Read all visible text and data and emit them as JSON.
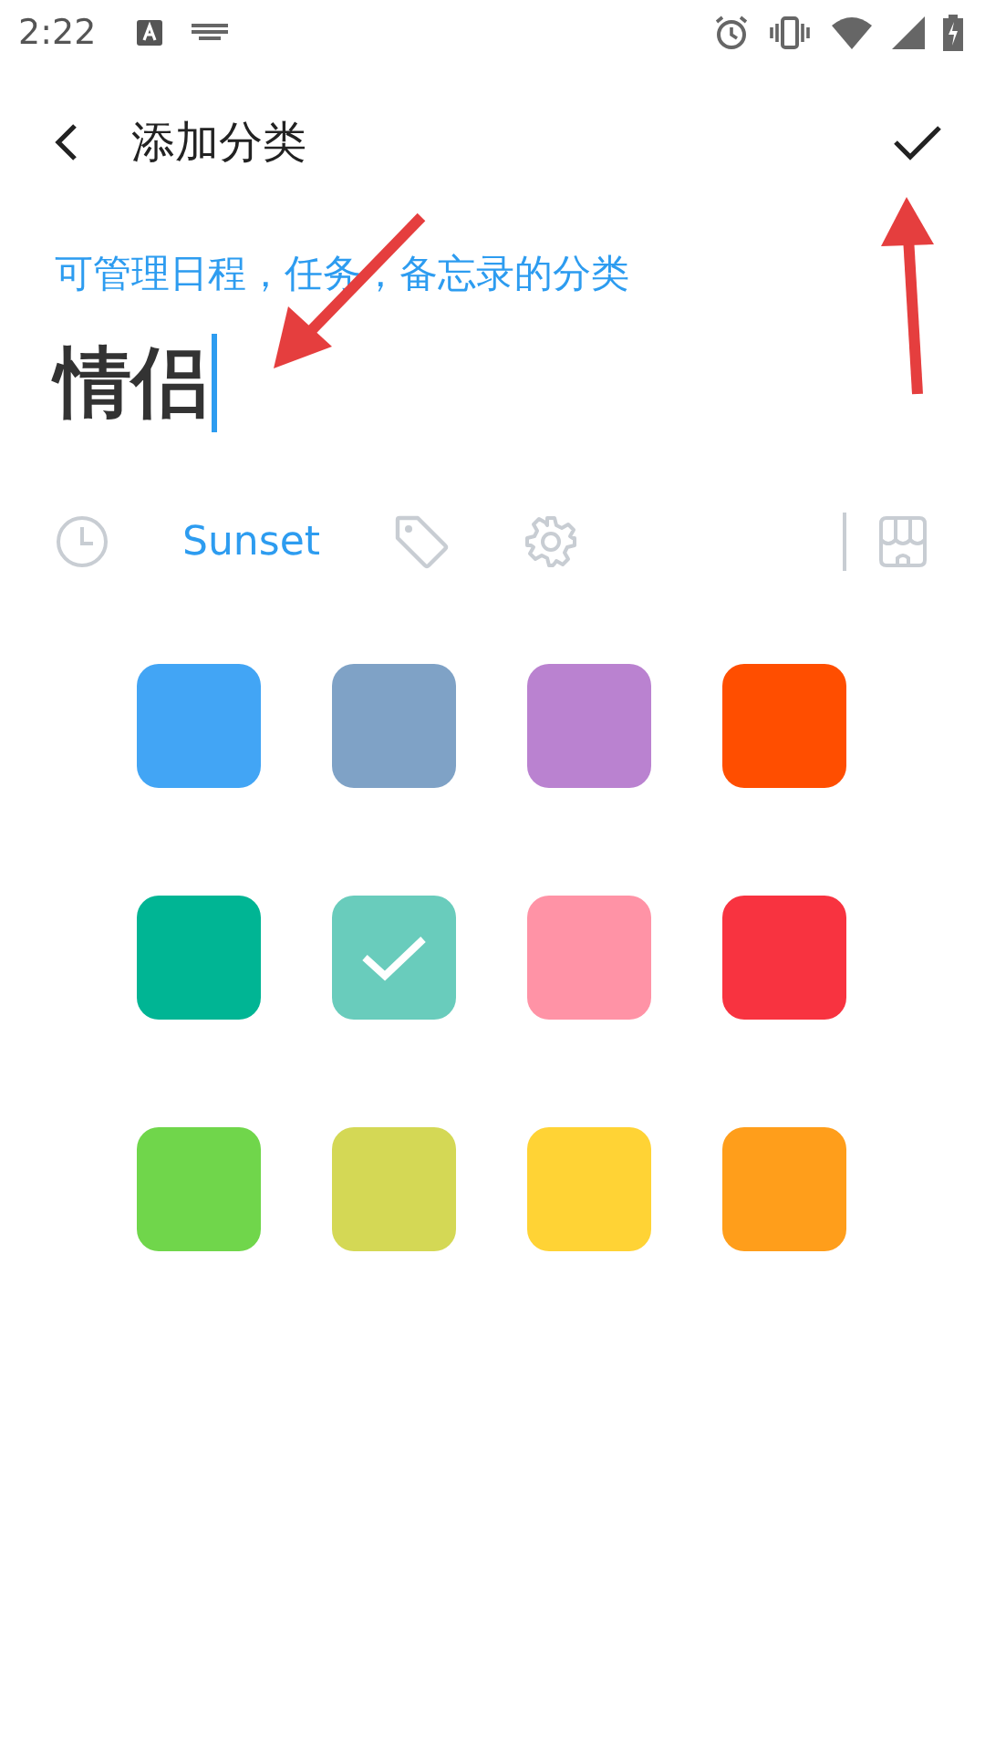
{
  "status_bar": {
    "time": "2:22"
  },
  "header": {
    "title": "添加分类"
  },
  "hint": "可管理日程，任务，备忘录的分类",
  "name_field": {
    "value": "情侣"
  },
  "toolbar": {
    "theme": "Sunset"
  },
  "colors": [
    {
      "color": "#42a5f5",
      "selected": false
    },
    {
      "color": "#7fa2c6",
      "selected": false
    },
    {
      "color": "#ba82d0",
      "selected": false
    },
    {
      "color": "#ff4e00",
      "selected": false
    },
    {
      "color": "#00b594",
      "selected": false
    },
    {
      "color": "#69ccbc",
      "selected": true
    },
    {
      "color": "#ff93a6",
      "selected": false
    },
    {
      "color": "#f83340",
      "selected": false
    },
    {
      "color": "#70d64b",
      "selected": false
    },
    {
      "color": "#d4d855",
      "selected": false
    },
    {
      "color": "#ffd335",
      "selected": false
    },
    {
      "color": "#ff9e1b",
      "selected": false
    }
  ]
}
